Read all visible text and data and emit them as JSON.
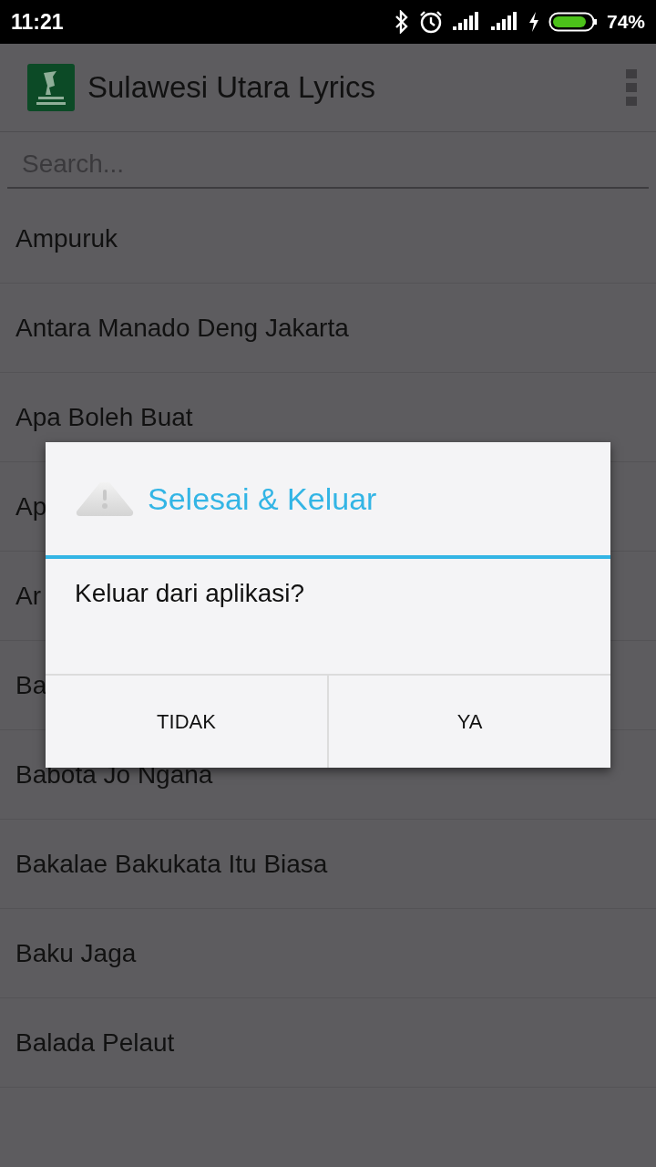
{
  "status_bar": {
    "time": "11:21",
    "battery_percent": "74%"
  },
  "app_bar": {
    "title": "Sulawesi Utara Lyrics"
  },
  "search": {
    "placeholder": "Search..."
  },
  "songs": [
    {
      "title": "Ampuruk"
    },
    {
      "title": "Antara Manado Deng Jakarta"
    },
    {
      "title": "Apa Boleh Buat"
    },
    {
      "title": "Ap"
    },
    {
      "title": "Ar"
    },
    {
      "title": "Ba"
    },
    {
      "title": "Babota Jo Ngana"
    },
    {
      "title": "Bakalae Bakukata Itu Biasa"
    },
    {
      "title": "Baku Jaga"
    },
    {
      "title": "Balada Pelaut"
    }
  ],
  "dialog": {
    "title": "Selesai & Keluar",
    "message": "Keluar dari aplikasi?",
    "buttons": [
      "TIDAK",
      "YA"
    ]
  }
}
